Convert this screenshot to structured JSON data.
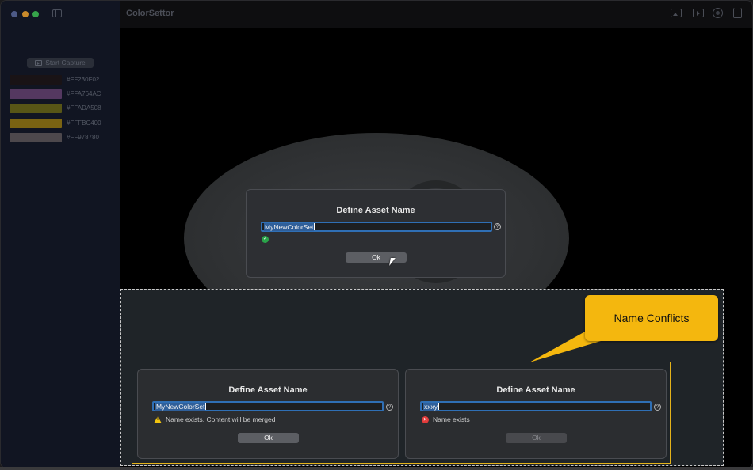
{
  "app": {
    "title": "ColorSettor"
  },
  "sidebar": {
    "capture_label": "Start Capture",
    "swatches": [
      {
        "hex": "#FF230F02",
        "color": "#231108"
      },
      {
        "hex": "#FFA764AC",
        "color": "#A764AC"
      },
      {
        "hex": "#FFADA508",
        "color": "#ADA508"
      },
      {
        "hex": "#FFFBC400",
        "color": "#FBC400"
      },
      {
        "hex": "#FF978780",
        "color": "#978780"
      }
    ]
  },
  "toolbar": {
    "icons": [
      "photo-icon",
      "play-icon",
      "eye-icon",
      "share-icon"
    ]
  },
  "dialog_main": {
    "title": "Define Asset Name",
    "value": "MyNewColorSet",
    "help": "?",
    "ok": "Ok"
  },
  "callout": {
    "text": "Name Conflicts"
  },
  "dialog_merge": {
    "title": "Define Asset Name",
    "value": "MyNewColorSet",
    "help": "?",
    "message": "Name exists. Content will be merged",
    "ok": "Ok"
  },
  "dialog_error": {
    "title": "Define Asset Name",
    "value": "xxxy",
    "help": "?",
    "message": "Name exists",
    "ok": "Ok"
  },
  "colors": {
    "accent": "#2F6FB5",
    "callout": "#F4B70E",
    "success": "#2AA44A",
    "error": "#E23B3B",
    "warning": "#F1C40F"
  }
}
